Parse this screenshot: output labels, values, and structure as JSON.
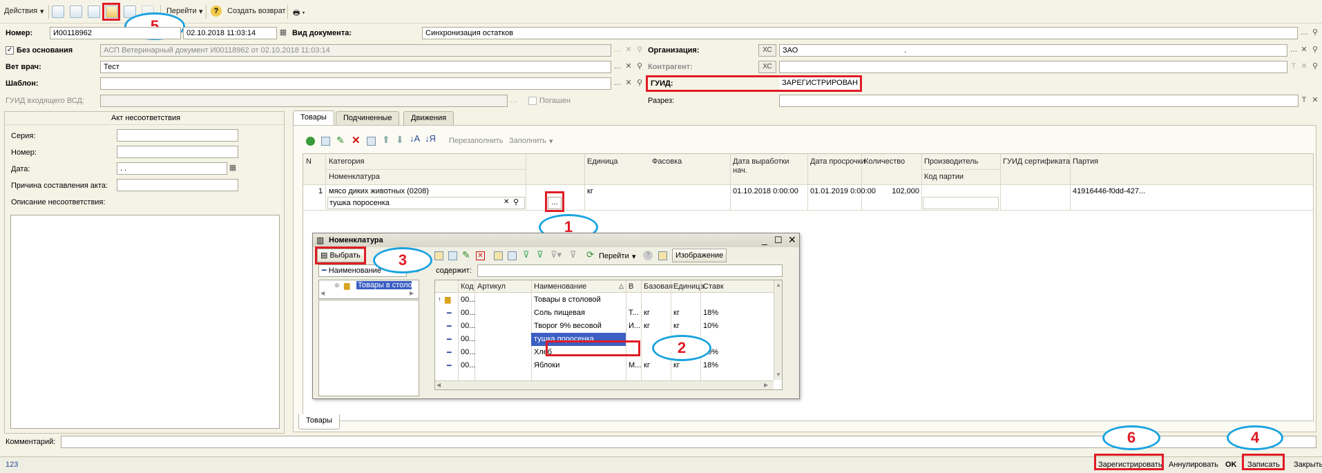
{
  "toolbar": {
    "actions": "Действия",
    "goto": "Перейти",
    "create_return": "Создать возврат",
    "help": "?"
  },
  "form": {
    "number_label": "Номер:",
    "number_value": "И00118962",
    "date_value": "02.10.2018 11:03:14",
    "doc_type_label": "Вид документа:",
    "doc_type_value": "Синхронизация остатков",
    "no_basis_label": "Без основания",
    "basis_value": "АСП Ветеринарный документ И00118962 от 02.10.2018 11:03:14",
    "org_label": "Организация:",
    "org_xc": "ХС",
    "org_value": "ЗАО",
    "org_value_dot": ".",
    "vet_label": "Вет врач:",
    "vet_value": "Тест",
    "contractor_label": "Контрагент:",
    "contractor_xc": "ХС",
    "template_label": "Шаблон:",
    "guid_label": "ГУИД:",
    "guid_value": "ЗАРЕГИСТРИРОВАН",
    "incoming_guid_label": "ГУИД входящего ВСД:",
    "repaid_label": "Погашен",
    "section_label": "Разрез:"
  },
  "act": {
    "title": "Акт несоответствия",
    "series_label": "Серия:",
    "number_label": "Номер:",
    "date_label": "Дата:",
    "date_value": " .  .",
    "reason_label": "Причина составления акта:",
    "description_label": "Описание несоответствия:"
  },
  "tabs": [
    "Товары",
    "Подчиненные",
    "Движения"
  ],
  "bottom_tab": "Товары",
  "goods_toolbar": {
    "refill": "Перезаполнить",
    "fill": "Заполнить"
  },
  "goods_table": {
    "headers": {
      "n": "N",
      "category": "Категория",
      "nomenclature": "Номенклатура",
      "unit": "Единица",
      "packing": "Фасовка",
      "prod_date": "Дата выработки",
      "prod_date2": "нач.",
      "expiry": "Дата просрочки",
      "quantity": "Количество",
      "producer": "Производитель",
      "batch_code": "Код партии",
      "cert_guid": "ГУИД сертификата",
      "batch": "Партия"
    },
    "row": {
      "n": "1",
      "category": "мясо диких животных (0208)",
      "nomenclature": "тушка поросенка",
      "unit": "кг",
      "prod_date": "01.10.2018 0:00:00",
      "expiry": "01.01.2019 0:00:00",
      "quantity": "102,000",
      "batch": "41916446-f0dd-427..."
    },
    "ellipsis": "..."
  },
  "nomenclature_window": {
    "title": "Номенклатура",
    "select_btn": "Выбрать",
    "goto": "Перейти",
    "image_btn": "Изображение",
    "field_selector": "Наименование",
    "contains_label": "содержит:",
    "tree_item": "Товары в столо",
    "headers": [
      "Код",
      "Артикул",
      "Наименование",
      "В",
      "Базовая",
      "Единица",
      "Ставк"
    ],
    "rows": [
      {
        "code": "00...",
        "article": "",
        "name": "Товары в столовой",
        "v": "",
        "base": "",
        "unit": "",
        "rate": "",
        "folder": true
      },
      {
        "code": "00...",
        "article": "",
        "name": "Соль пищевая",
        "v": "Т...",
        "base": "кг",
        "unit": "кг",
        "rate": "18%"
      },
      {
        "code": "00...",
        "article": "",
        "name": "Творог 9% весовой",
        "v": "И...",
        "base": "кг",
        "unit": "кг",
        "rate": "10%"
      },
      {
        "code": "00...",
        "article": "",
        "name": "тушка поросенка",
        "v": "",
        "base": "",
        "unit": "кг",
        "rate": ""
      },
      {
        "code": "00...",
        "article": "",
        "name": "Хлеб",
        "v": "",
        "base": "",
        "unit": "шт",
        "rate": "10%"
      },
      {
        "code": "00...",
        "article": "",
        "name": "Яблоки",
        "v": "М...",
        "base": "кг",
        "unit": "кг",
        "rate": "18%"
      }
    ]
  },
  "comment_label": "Комментарий:",
  "status": {
    "code": "123",
    "register": "Зарегистрировать",
    "annul": "Аннулировать",
    "ok": "OK",
    "save": "Записать",
    "close": "Закрыть"
  },
  "callouts": [
    "1",
    "2",
    "3",
    "4",
    "5",
    "6"
  ],
  "colors": {
    "highlight_red": "#e01b24",
    "callout_blue": "#1aa3e0",
    "selection": "#3b5fc2"
  }
}
